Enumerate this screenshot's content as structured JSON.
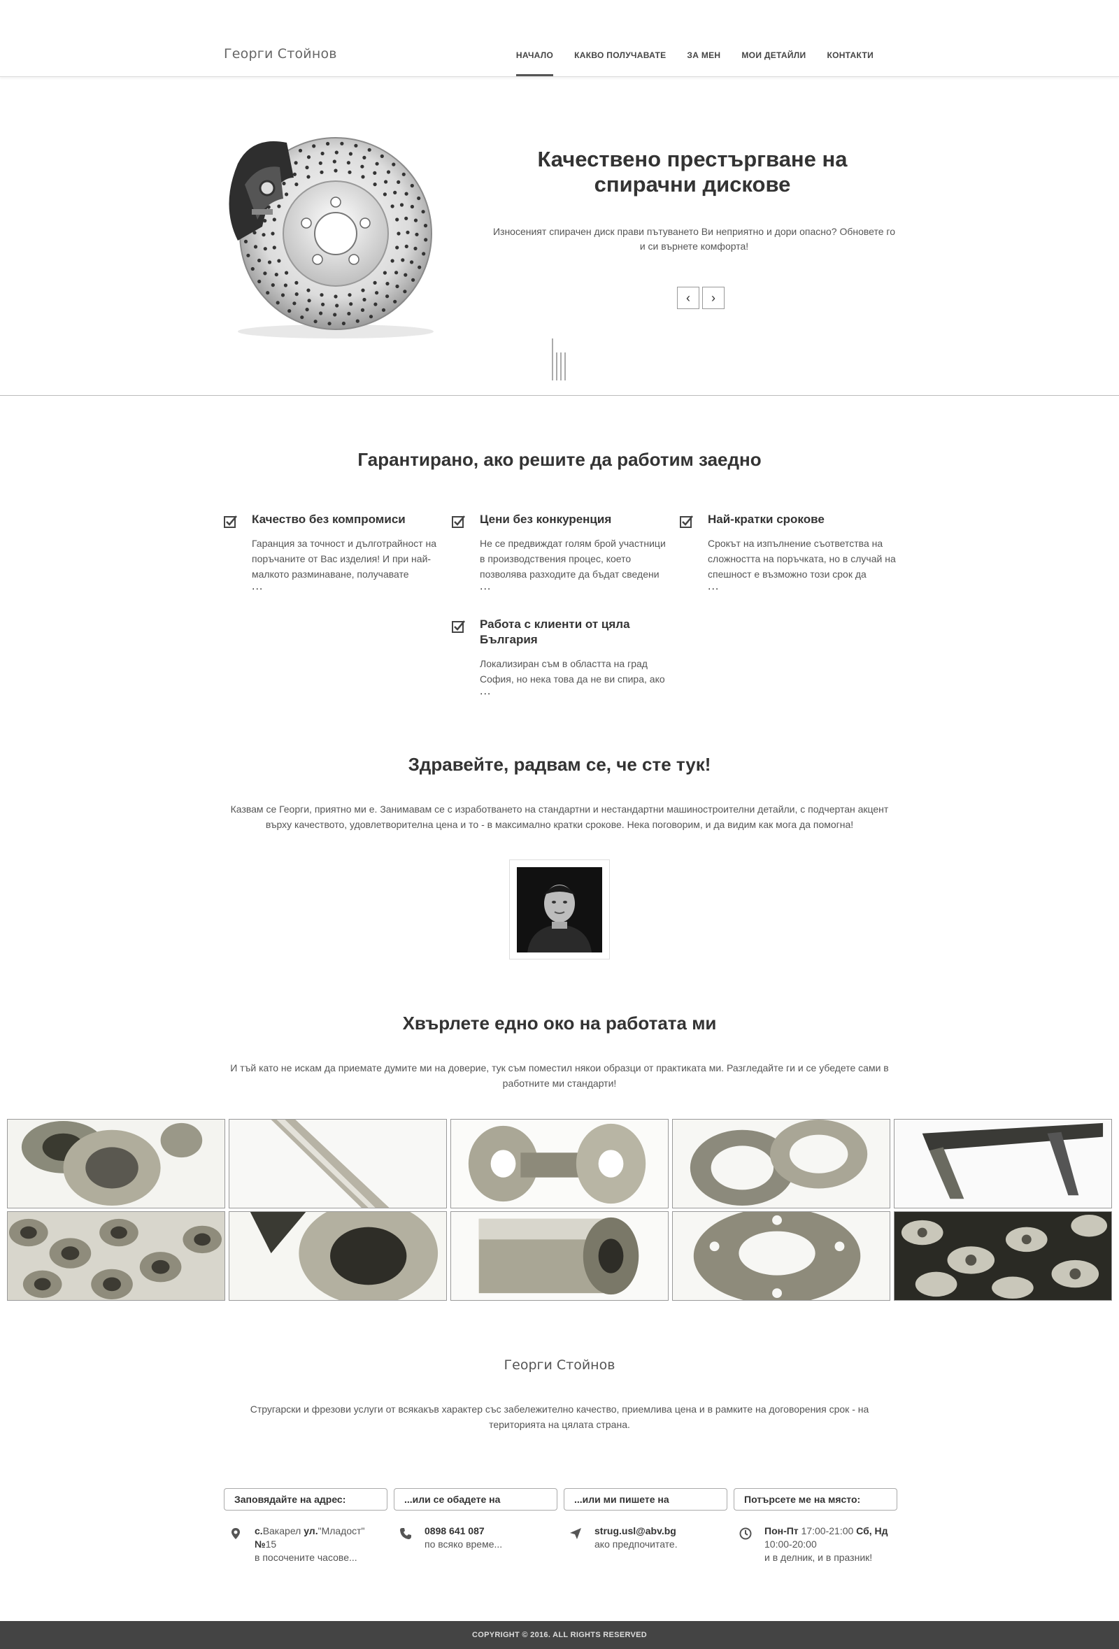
{
  "header": {
    "logo": "Георги Стойнов",
    "nav": [
      "НАЧАЛО",
      "КАКВО ПОЛУЧАВАТЕ",
      "ЗА МЕН",
      "МОИ ДЕТАЙЛИ",
      "КОНТАКТИ"
    ],
    "active_index": 0
  },
  "hero": {
    "title_line1": "Качествено престъргване на",
    "title_line2": "спирачни дискове",
    "text": "Износеният спирачен диск прави пътуването Ви неприятно и дори опасно? Обновете го и си върнете комфорта!",
    "prev_icon": "‹",
    "next_icon": "›"
  },
  "guarantee": {
    "title": "Гарантирано, ако решите да работим заедно",
    "features": [
      {
        "title": "Качество без компромиси",
        "text": "Гаранция за точност и дълготрайност на поръчаните от Вас изделия! И при най-малкото разминаване, получавате",
        "more": "..."
      },
      {
        "title": "Цени без конкуренция",
        "text": "Не се предвиждат голям брой участници в производствения процес, което позволява разходите да бъдат сведени",
        "more": "..."
      },
      {
        "title": "Най-кратки срокове",
        "text": "Срокът на изпълнение съответства на сложността на поръчката, но в случай на спешност е възможно този срок да",
        "more": "..."
      },
      {
        "title": "Работа с клиенти от цяла България",
        "text": "Локализиран съм в областта на град София, но нека това да не ви спира, ако",
        "more": "..."
      }
    ]
  },
  "about": {
    "title": "Здравейте, радвам се, че сте тук!",
    "text": "Казвам се Георги, приятно ми е. Занимавам се с изработването на стандартни и нестандартни машиностроителни детайли, с подчертан акцент върху качеството, удовлетворителна цена и то - в максимално кратки срокове. Нека поговорим, и да видим как мога да помогна!"
  },
  "work": {
    "title": "Хвърлете едно око на работата ми",
    "text": "И тъй като не искам да приемате думите ми на доверие, тук съм поместил някои образци от практиката ми. Разгледайте ги и се убедете сами в работните ми стандарти!"
  },
  "footer": {
    "name": "Георги Стойнов",
    "text": "Стругарски и фрезови услуги от всякакъв характер със забележително качество, приемлива цена и в рамките на договорения срок - на територията на цялата страна.",
    "tabs": [
      "Заповядайте на адрес:",
      "...или се обадете на",
      "...или ми пишете на",
      "Потърсете ме на място:"
    ],
    "address": {
      "prefix": "с.",
      "village": "Вакарел",
      "street_prefix": "ул.",
      "street": "\"Младост\"",
      "num_prefix": "№",
      "num": "15",
      "note": "в посочените часове..."
    },
    "phone": {
      "number": "0898 641 087",
      "note": "по всяко време..."
    },
    "email": {
      "address": "strug.usl@abv.bg",
      "note": "ако предпочитате."
    },
    "hours": {
      "weekdays": "Пон-Пт",
      "weekday_hours": "17:00-21:00",
      "weekend": "Сб, Нд",
      "weekend_hours": "10:00-20:00",
      "note": "и в делник, и в празник!"
    },
    "copyright": "COPYRIGHT © 2016. ALL RIGHTS RESERVED"
  }
}
